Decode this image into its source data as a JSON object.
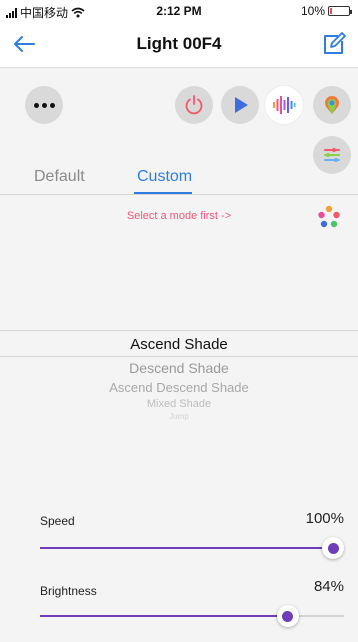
{
  "status_bar": {
    "carrier": "中国移动",
    "time": "2:12 PM",
    "battery": "10%",
    "battery_level": 0.1
  },
  "nav": {
    "title": "Light 00F4",
    "back_icon": "arrow-left-icon",
    "edit_icon": "edit-square-icon"
  },
  "controls": {
    "icons": [
      "more-dots-icon",
      "power-icon",
      "play-icon",
      "sound-wave-icon",
      "color-palette-icon",
      "sliders-icon"
    ]
  },
  "tabs": [
    {
      "label": "Default",
      "active": false
    },
    {
      "label": "Custom",
      "active": true
    }
  ],
  "hint": "Select a mode first ->",
  "modes": [
    "Ascend Shade",
    "Descend Shade",
    "Ascend Descend Shade",
    "Mixed Shade",
    "Jump"
  ],
  "selected_mode": "Ascend Shade",
  "sliders": {
    "speed": {
      "label": "Speed",
      "value_text": "100%",
      "value": 1.0
    },
    "brightness": {
      "label": "Brightness",
      "value_text": "84%",
      "value": 0.84
    }
  },
  "colors": {
    "accent": "#2f7de1",
    "slider": "#6e3fb8",
    "hint": "#f05a78",
    "power": "#f05a6a",
    "play": "#3d6ee0"
  }
}
